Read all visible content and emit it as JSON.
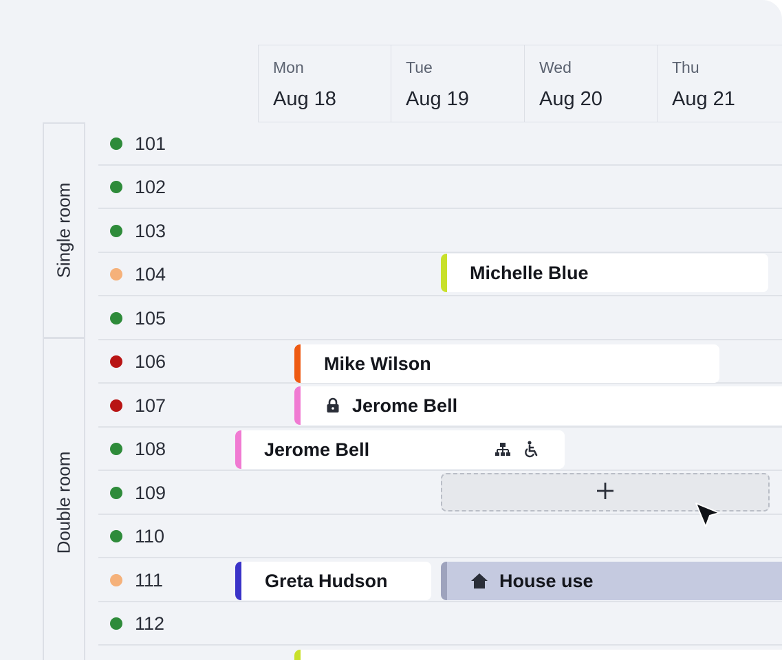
{
  "days": [
    {
      "dow": "Mon",
      "date": "Aug 18"
    },
    {
      "dow": "Tue",
      "date": "Aug 19"
    },
    {
      "dow": "Wed",
      "date": "Aug 20"
    },
    {
      "dow": "Thu",
      "date": "Aug 21"
    }
  ],
  "categories": [
    {
      "label": "Single room"
    },
    {
      "label": "Double room"
    }
  ],
  "rooms": [
    {
      "number": "101",
      "status_color": "#2e8b3a"
    },
    {
      "number": "102",
      "status_color": "#2e8b3a"
    },
    {
      "number": "103",
      "status_color": "#2e8b3a"
    },
    {
      "number": "104",
      "status_color": "#f5b17a"
    },
    {
      "number": "105",
      "status_color": "#2e8b3a"
    },
    {
      "number": "106",
      "status_color": "#b81414"
    },
    {
      "number": "107",
      "status_color": "#b81414"
    },
    {
      "number": "108",
      "status_color": "#2e8b3a"
    },
    {
      "number": "109",
      "status_color": "#2e8b3a"
    },
    {
      "number": "110",
      "status_color": "#2e8b3a"
    },
    {
      "number": "111",
      "status_color": "#f5b17a"
    },
    {
      "number": "112",
      "status_color": "#2e8b3a"
    }
  ],
  "bookings": [
    {
      "guest": "Michelle Blue",
      "room": "104",
      "accent": "#c8e02a"
    },
    {
      "guest": "Mike Wilson",
      "room": "106",
      "accent": "#ee5a12"
    },
    {
      "guest": "Jerome Bell",
      "room": "107",
      "accent": "#f07ad2",
      "icon": "lock-icon"
    },
    {
      "guest": "Jerome Bell",
      "room": "108",
      "accent": "#f07ad2",
      "icons": [
        "sitemap-icon",
        "wheelchair-icon"
      ]
    },
    {
      "guest": "Greta Hudson",
      "room": "111",
      "accent": "#3a33c8"
    },
    {
      "guest": "House use",
      "room": "111",
      "accent": "#9ea3bd",
      "background": "#c5cae0",
      "icon": "house-icon"
    }
  ],
  "add_slot": {
    "icon": "plus-icon",
    "room": "109"
  }
}
